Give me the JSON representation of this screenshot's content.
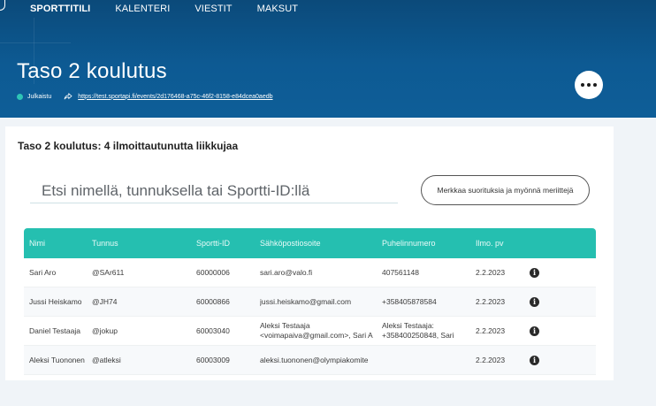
{
  "nav": {
    "items": [
      {
        "label": "SPORTTITILI",
        "active": true
      },
      {
        "label": "KALENTERI",
        "active": false
      },
      {
        "label": "VIESTIT",
        "active": false
      },
      {
        "label": "MAKSUT",
        "active": false
      }
    ]
  },
  "event": {
    "title": "Taso 2 koulutus",
    "status": "Julkaistu",
    "status_color": "#2ec4b6",
    "url": "https://test.sportapi.fi/events/2d176468-a75c-46f2-8158-e84dcea0aedb"
  },
  "participants": {
    "heading": "Taso 2 koulutus: 4 ilmoittautunutta liikkujaa",
    "search_placeholder": "Etsi nimellä, tunnuksella tai Sportti-ID:llä",
    "mark_button": "Merkkaa suorituksia ja myönnä meriittejä",
    "columns": [
      "Nimi",
      "Tunnus",
      "Sportti-ID",
      "Sähköpostiosoite",
      "Puhelinnumero",
      "Ilmo. pv"
    ],
    "rows": [
      {
        "nimi": "Sari Aro",
        "tunnus": "@SAr611",
        "id": "60000006",
        "email": [
          "sari.aro@valo.fi"
        ],
        "phone": [
          "407561148"
        ],
        "pv": "2.2.2023"
      },
      {
        "nimi": "Jussi Heiskamo",
        "tunnus": "@JH74",
        "id": "60000866",
        "email": [
          "jussi.heiskamo@gmail.com"
        ],
        "phone": [
          "+358405878584"
        ],
        "pv": "2.2.2023"
      },
      {
        "nimi": "Daniel Testaaja",
        "tunnus": "@jokup",
        "id": "60003040",
        "email": [
          "Aleksi Testaaja",
          "<voimapaiva@gmail.com>, Sari A"
        ],
        "phone": [
          "Aleksi Testaaja:",
          "+358400250848, Sari"
        ],
        "pv": "2.2.2023"
      },
      {
        "nimi": "Aleksi Tuononen",
        "tunnus": "@atleksi",
        "id": "60003009",
        "email": [
          "aleksi.tuononen@olympiakomite"
        ],
        "phone": [],
        "pv": "2.2.2023"
      }
    ]
  },
  "colors": {
    "header_bg": "#0d5a93",
    "table_header": "#25bfb0"
  },
  "icons": {
    "more": "more-horizontal-icon",
    "share": "share-arrow-icon",
    "info": "info-icon"
  }
}
